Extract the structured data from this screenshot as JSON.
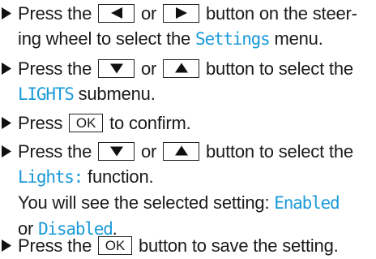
{
  "steps": [
    {
      "p1": "Press the",
      "k1": "left-arrow-key",
      "p2": "or",
      "k2": "right-arrow-key",
      "p3": "button on the steer-",
      "l2a": "ing wheel to select the",
      "hl1": "Settings",
      "l2b": "menu."
    },
    {
      "p1": "Press the",
      "k1": "down-arrow-key",
      "p2": "or",
      "k2": "up-arrow-key",
      "p3": "button to select the",
      "hl1": "LIGHTS",
      "l2b": "submenu."
    },
    {
      "p1": "Press",
      "ok": "OK",
      "p2": "to confirm."
    },
    {
      "p1": "Press the",
      "k1": "down-arrow-key",
      "p2": "or",
      "k2": "up-arrow-key",
      "p3": "button to select the",
      "hl1": "Lights:",
      "l2b": "function.",
      "l3a": "You will see the selected setting:",
      "hl2": "Enabled",
      "l4a": "or",
      "hl3": "Disabled",
      "l4b": "."
    },
    {
      "p1": "Press the",
      "ok": "OK",
      "p2": "button to save the setting."
    }
  ]
}
